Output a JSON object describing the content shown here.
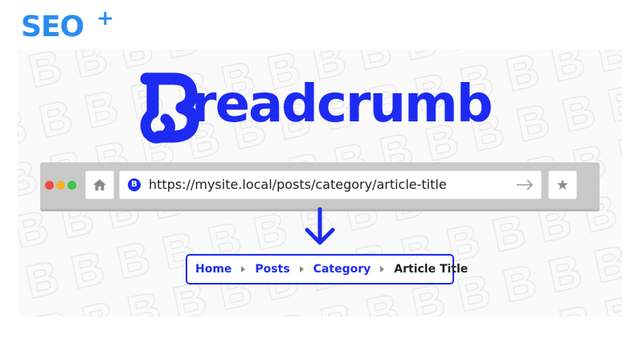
{
  "logo": {
    "text": "SEO",
    "plus": "+"
  },
  "headline": {
    "title": "readcrumb",
    "icon": "breadcrumb-b-logo-icon"
  },
  "browser": {
    "window_controls": [
      "close",
      "minimize",
      "maximize"
    ],
    "home_icon": "home-icon",
    "favicon_icon": "site-favicon-icon",
    "favicon_text": "B",
    "url": "https://mysite.local/posts/category/article-title",
    "go_icon": "arrow-right-icon",
    "bookmark_icon": "star-icon",
    "bookmark_glyph": "★"
  },
  "arrow_icon": "arrow-down-icon",
  "breadcrumb": {
    "items": [
      {
        "label": "Home"
      },
      {
        "label": "Posts"
      },
      {
        "label": "Category"
      },
      {
        "label": "Article Title"
      }
    ]
  },
  "colors": {
    "brand_blue": "#1d2bf2",
    "logo_blue": "#2a8cf0",
    "browser_gray": "#c9c9c9"
  }
}
